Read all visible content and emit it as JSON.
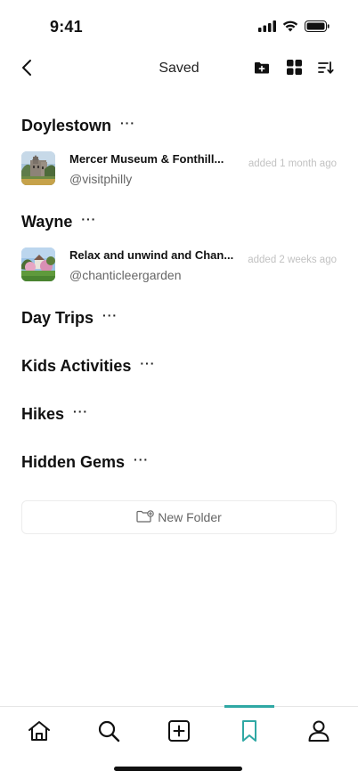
{
  "status_bar": {
    "time": "9:41"
  },
  "nav": {
    "title": "Saved"
  },
  "folders": [
    {
      "name": "Doylestown",
      "more": "···",
      "items": [
        {
          "title": "Mercer Museum & Fonthill...",
          "author": "@visitphilly",
          "time": "added 1 month ago"
        }
      ]
    },
    {
      "name": "Wayne",
      "more": "···",
      "items": [
        {
          "title": "Relax and unwind and Chan...",
          "author": "@chanticleergarden",
          "time": "added 2 weeks ago"
        }
      ]
    },
    {
      "name": "Day Trips",
      "more": "···",
      "items": []
    },
    {
      "name": "Kids Activities",
      "more": "···",
      "items": []
    },
    {
      "name": "Hikes",
      "more": "···",
      "items": []
    },
    {
      "name": "Hidden Gems",
      "more": "···",
      "items": []
    }
  ],
  "new_folder": {
    "label": "New Folder"
  },
  "tabbar": {
    "active": "saved",
    "accent": "#2fa8a4"
  },
  "icons": {
    "back": "chevron-left-icon",
    "add_folder": "folder-plus-icon",
    "grid": "grid-icon",
    "sort": "sort-icon",
    "home": "home-icon",
    "search": "search-icon",
    "create": "plus-square-icon",
    "saved": "bookmark-icon",
    "profile": "user-icon"
  }
}
